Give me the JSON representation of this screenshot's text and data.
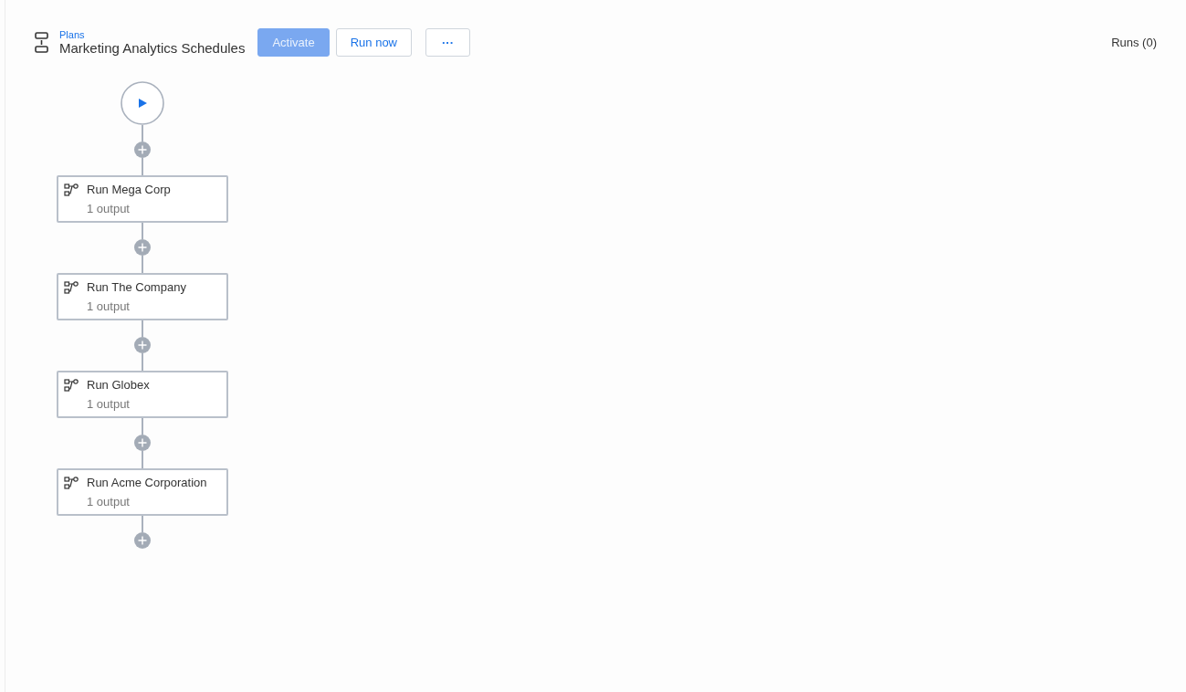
{
  "header": {
    "breadcrumb": "Plans",
    "title": "Marketing Analytics Schedules",
    "buttons": [
      {
        "label": "Activate",
        "kind": "primary",
        "disabled": true
      },
      {
        "label": "Run now",
        "kind": "secondary",
        "disabled": false
      },
      {
        "label": "···",
        "kind": "more",
        "disabled": false
      }
    ],
    "runs": "Runs (0)"
  },
  "flow": {
    "steps": [
      {
        "title": "Run Mega Corp",
        "subtitle": "1 output"
      },
      {
        "title": "Run The Company",
        "subtitle": "1 output"
      },
      {
        "title": "Run Globex",
        "subtitle": "1 output"
      },
      {
        "title": "Run Acme Corporation",
        "subtitle": "1 output"
      }
    ]
  }
}
